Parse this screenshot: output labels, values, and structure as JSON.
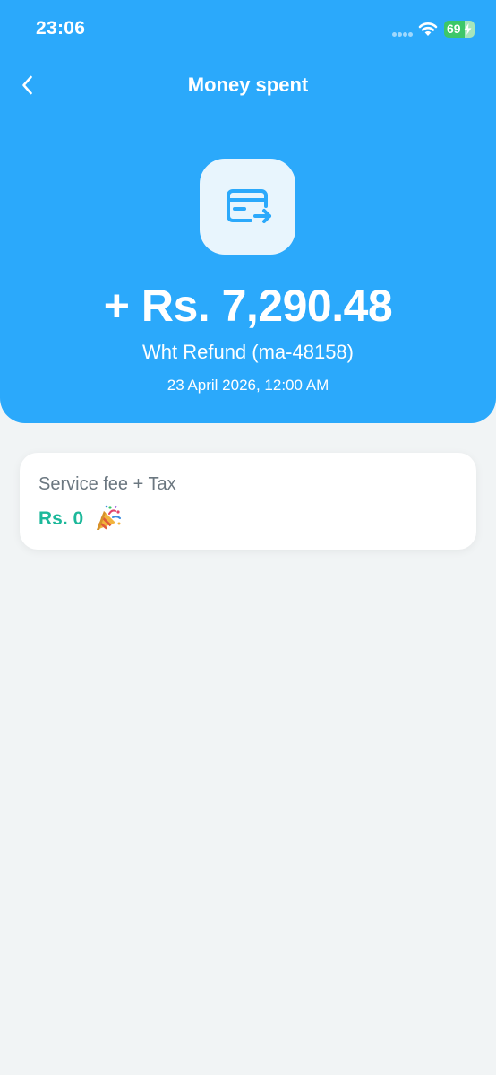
{
  "status_bar": {
    "time": "23:06",
    "battery_level": "69",
    "battery_fraction": 0.69,
    "icons": [
      "signal-icon",
      "wifi-icon",
      "battery-icon",
      "charging-bolt-icon"
    ]
  },
  "header": {
    "back_icon": "chevron-left-icon",
    "title": "Money spent",
    "background_color": "#2ba9fb"
  },
  "transaction": {
    "icon": "card-transfer-icon",
    "amount": "+ Rs. 7,290.48",
    "description": "Wht Refund (ma-48158)",
    "datetime": "23 April 2026, 12:00 AM"
  },
  "fee_card": {
    "label": "Service fee + Tax",
    "value": "Rs. 0",
    "icon": "party-popper-icon",
    "value_color": "#1cb89a"
  }
}
